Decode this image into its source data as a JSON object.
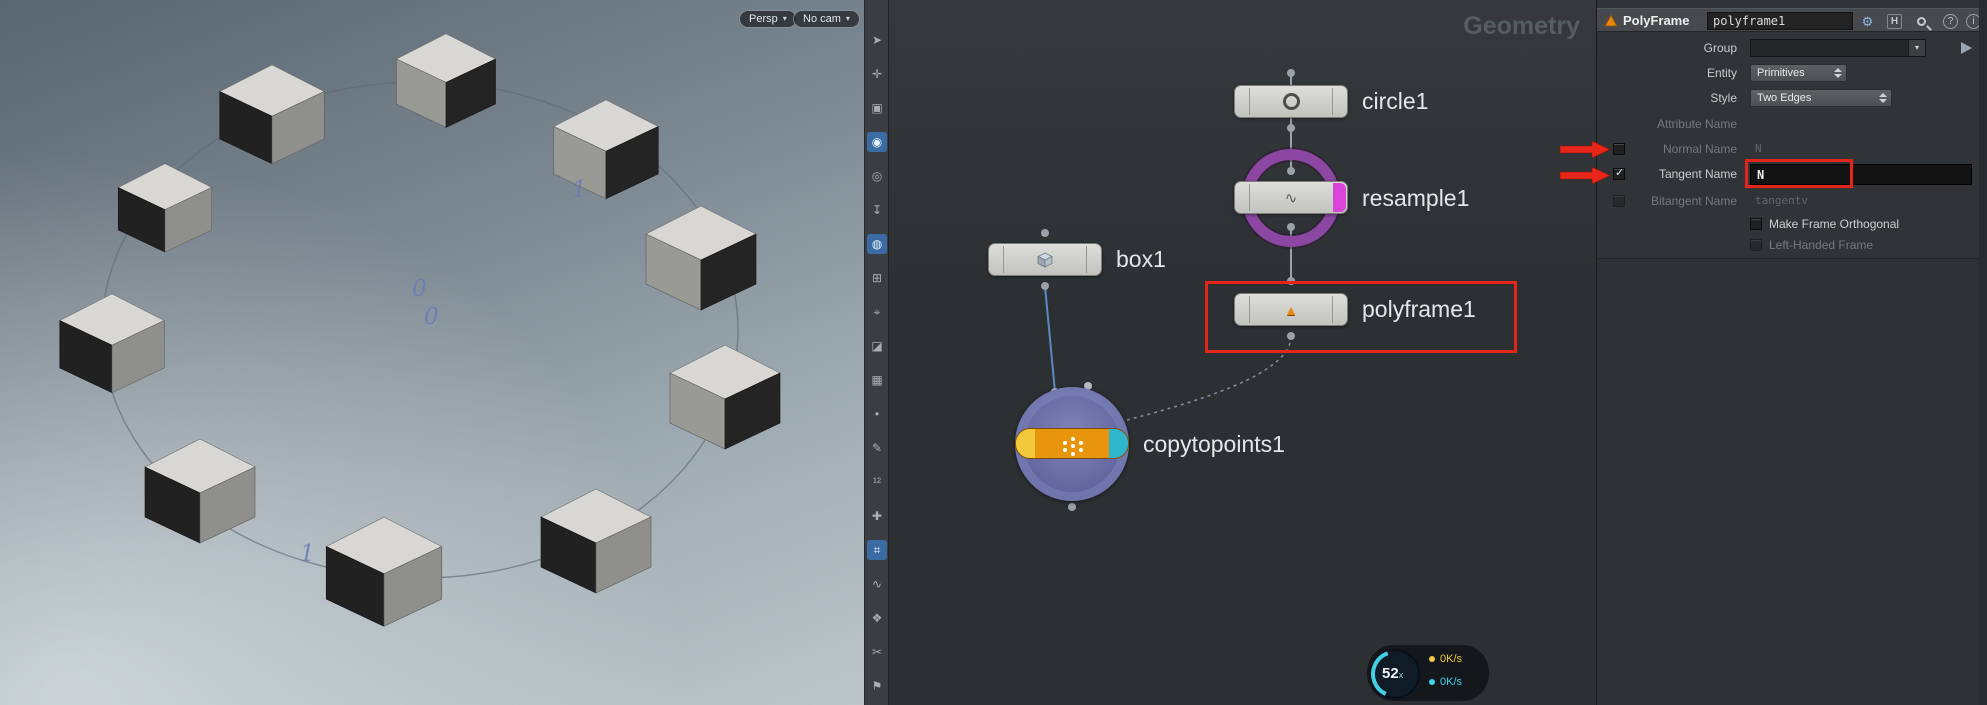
{
  "ui": {
    "caret": "▾",
    "check": "✓"
  },
  "viewport": {
    "persp_label": "Persp",
    "camera_label": "No cam",
    "markers": [
      {
        "text": "0"
      },
      {
        "text": "0"
      },
      {
        "text": "1"
      },
      {
        "text": "1"
      }
    ]
  },
  "toolbar": {
    "icons": [
      {
        "name": "select-icon",
        "glyph": "➤"
      },
      {
        "name": "move-icon",
        "glyph": "✛"
      },
      {
        "name": "lock-icon",
        "glyph": "▣"
      },
      {
        "name": "camera-icon",
        "glyph": "◉"
      },
      {
        "name": "globe-icon",
        "glyph": "◎"
      },
      {
        "name": "pin-icon",
        "glyph": "↧"
      },
      {
        "name": "magnet-icon",
        "glyph": "◍"
      },
      {
        "name": "grid-snap-icon",
        "glyph": "⊞"
      },
      {
        "name": "point-snap-icon",
        "glyph": "⌖"
      },
      {
        "name": "shade-icon",
        "glyph": "◪"
      },
      {
        "name": "wireframe-icon",
        "glyph": "▦"
      },
      {
        "name": "dot-icon",
        "glyph": "•"
      },
      {
        "name": "pen-icon",
        "glyph": "✎"
      },
      {
        "name": "point-numbers-icon",
        "glyph": "¹²"
      },
      {
        "name": "axis-icon",
        "glyph": "✚"
      },
      {
        "name": "measure-icon",
        "glyph": "⌗"
      },
      {
        "name": "wave-icon",
        "glyph": "∿"
      },
      {
        "name": "diamond-icon",
        "glyph": "❖"
      },
      {
        "name": "cut-icon",
        "glyph": "✂"
      },
      {
        "name": "flag-icon",
        "glyph": "⚑"
      }
    ]
  },
  "network": {
    "title": "Geometry",
    "nodes": {
      "circle": {
        "label": "circle1"
      },
      "resample": {
        "label": "resample1"
      },
      "box": {
        "label": "box1"
      },
      "polyframe": {
        "label": "polyframe1"
      },
      "copytopoints": {
        "label": "copytopoints1"
      }
    },
    "node_icons": {
      "resample_glyph": "∿",
      "polyframe_glyph": "▲"
    },
    "gauge": {
      "value": "52",
      "unit": "x",
      "rate_up": "0K/s",
      "rate_down": "0K/s"
    }
  },
  "params": {
    "header": {
      "type_label": "PolyFrame",
      "name_value": "polyframe1",
      "gear_glyph": "⚙",
      "hscript_glyph": "H",
      "help_glyph": "?",
      "info_glyph": "i"
    },
    "group": {
      "label": "Group"
    },
    "entity": {
      "label": "Entity",
      "value": "Primitives"
    },
    "style": {
      "label": "Style",
      "value": "Two Edges"
    },
    "attribute": {
      "label": "Attribute Name"
    },
    "normal": {
      "label": "Normal Name",
      "value": "N"
    },
    "tangent": {
      "label": "Tangent Name",
      "value": "N"
    },
    "bitangent": {
      "label": "Bitangent Name",
      "value": "tangentv"
    },
    "orthogonal": {
      "label": "Make Frame Orthogonal"
    },
    "lefthanded": {
      "label": "Left-Handed Frame"
    }
  }
}
